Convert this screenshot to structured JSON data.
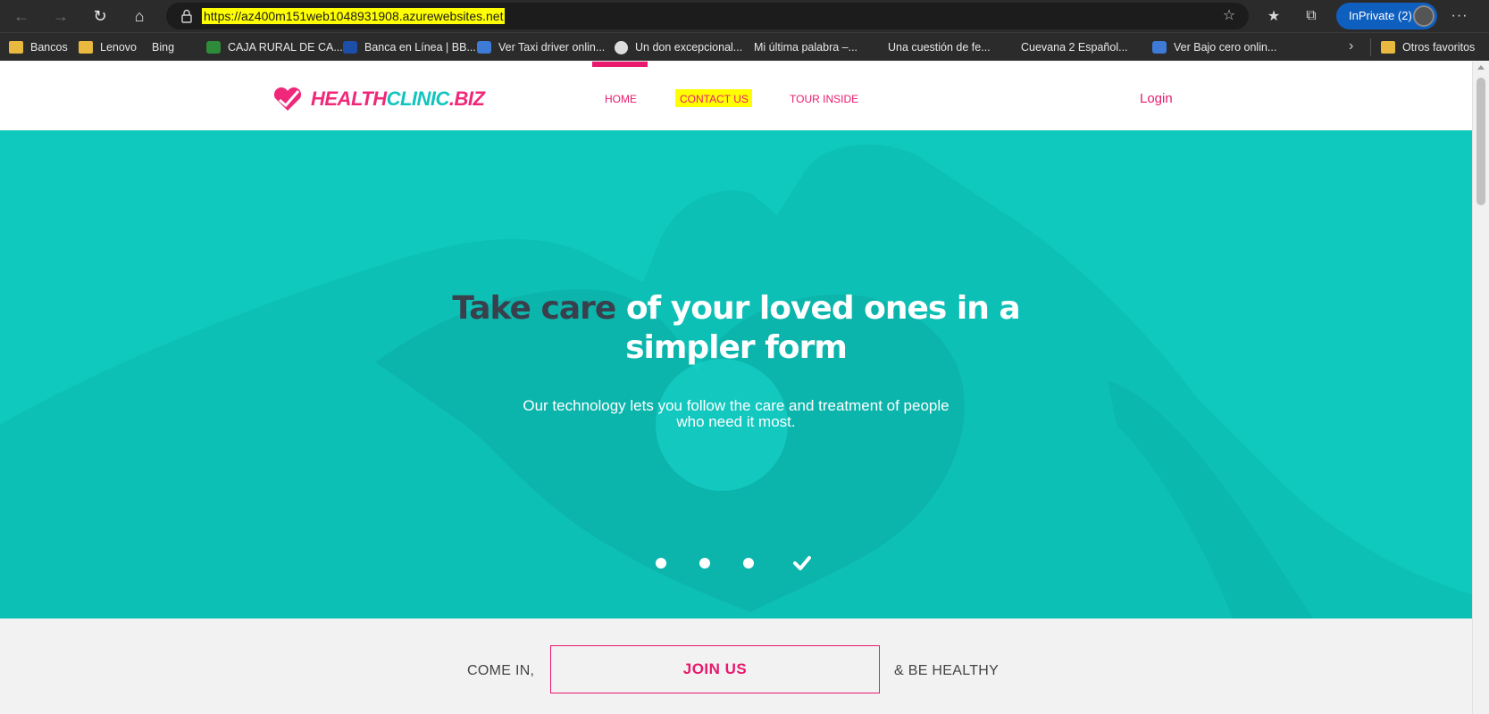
{
  "browser": {
    "url": "https://az400m151web1048931908.azurewebsites.net",
    "inprivate_label": "InPrivate (2)",
    "favorites": [
      {
        "label": "Bancos",
        "icon": "folder-icon"
      },
      {
        "label": "Lenovo",
        "icon": "folder-icon"
      },
      {
        "label": "Bing",
        "icon": "page-icon"
      },
      {
        "label": "CAJA RURAL DE CA...",
        "icon": "bank-icon"
      },
      {
        "label": "Banca en Línea | BB...",
        "icon": "bank-icon"
      },
      {
        "label": "Ver Taxi driver onlin...",
        "icon": "video-icon"
      },
      {
        "label": "Un don excepcional...",
        "icon": "wordpress-icon"
      },
      {
        "label": "Mi última palabra –...",
        "icon": "page-icon"
      },
      {
        "label": "Una cuestión de fe...",
        "icon": "page-icon"
      },
      {
        "label": "Cuevana 2 Español...",
        "icon": "page-icon"
      },
      {
        "label": "Ver Bajo cero onlin...",
        "icon": "video-icon"
      }
    ],
    "other_favorites": "Otros favoritos"
  },
  "site": {
    "logo": {
      "part1": "HEALTH",
      "part2": "CLINIC",
      "part3": ".BIZ"
    },
    "nav": {
      "home": "HOME",
      "contact": "CONTACT US",
      "tour": "TOUR INSIDE"
    },
    "login": "Login",
    "hero": {
      "title_dark": "Take care",
      "title_light": " of your loved ones in a simpler form",
      "subtitle": "Our technology lets you follow the care and treatment of people who need it most.",
      "slide_count": 4,
      "active_slide": 4
    },
    "cta": {
      "left": "COME IN,",
      "button": "JOIN US",
      "right": "& BE HEALTHY"
    }
  },
  "colors": {
    "accent": "#e8196e",
    "teal": "#0fc9be",
    "dark_text": "#3a3f4c",
    "highlight": "#ffff00",
    "inprivate": "#0f5fbf"
  }
}
